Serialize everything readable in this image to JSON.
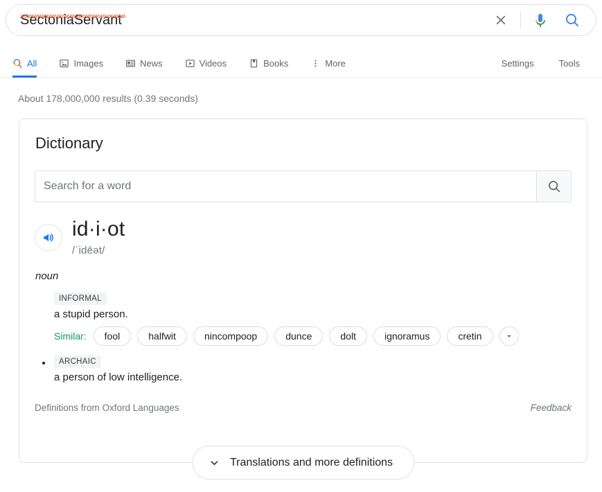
{
  "search": {
    "query": "SectoniaServant",
    "clear_label": "X",
    "icons": {
      "clear": "close-icon",
      "mic": "microphone-icon",
      "search": "search-icon"
    }
  },
  "nav": {
    "tabs": [
      {
        "label": "All",
        "icon": "google-search-icon",
        "active": true
      },
      {
        "label": "Images",
        "icon": "image-icon",
        "active": false
      },
      {
        "label": "News",
        "icon": "news-icon",
        "active": false
      },
      {
        "label": "Videos",
        "icon": "video-play-icon",
        "active": false
      },
      {
        "label": "Books",
        "icon": "book-icon",
        "active": false
      },
      {
        "label": "More",
        "icon": "more-vertical-icon",
        "active": false
      }
    ],
    "settings_label": "Settings",
    "tools_label": "Tools"
  },
  "result_stats": "About 178,000,000 results (0.39 seconds)",
  "dictionary": {
    "title": "Dictionary",
    "search_placeholder": "Search for a word",
    "search_value": "",
    "headword": "id·i·ot",
    "phonetic": "/ˈidēət/",
    "part_of_speech": "noun",
    "senses": [
      {
        "tag": "INFORMAL",
        "text": "a stupid person.",
        "bulleted": false
      },
      {
        "tag": "ARCHAIC",
        "text": "a person of low intelligence.",
        "bulleted": true
      }
    ],
    "similar_label": "Similar:",
    "similar_words": [
      "fool",
      "halfwit",
      "nincompoop",
      "dunce",
      "dolt",
      "ignoramus",
      "cretin"
    ],
    "similar_more_icon": "chevron-down-icon",
    "source": "Definitions from Oxford Languages",
    "feedback_label": "Feedback",
    "expand_label": "Translations and more definitions",
    "expand_icon": "chevron-down-icon"
  },
  "colors": {
    "accent_blue": "#1a73e8",
    "text_primary": "#202124",
    "text_secondary": "#70757a",
    "similar_green": "#0f9d58",
    "border": "#dfe1e5",
    "spellcheck_red": "#ea6d4a"
  }
}
